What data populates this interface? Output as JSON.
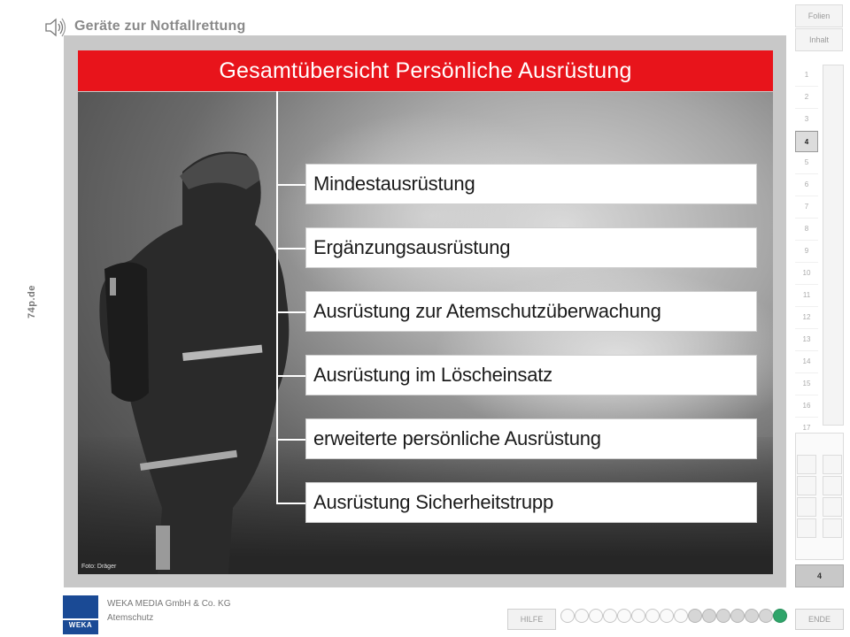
{
  "header": {
    "title": "Geräte zur Notfallrettung",
    "speaker_icon": "speaker-icon",
    "side_brand": "74p.de"
  },
  "slide": {
    "title": "Gesamtübersicht Persönliche Ausrüstung",
    "photo_credit": "Foto: Dräger",
    "items": [
      "Mindestausrüstung",
      "Ergänzungsausrüstung",
      "Ausrüstung zur Atemschutzüberwachung",
      "Ausrüstung im Löscheinsatz",
      "erweiterte persönliche Ausrüstung",
      "Ausrüstung Sicherheitstrupp"
    ]
  },
  "nav": {
    "folien": "Folien",
    "inhalt": "Inhalt",
    "slides": [
      "1",
      "2",
      "3",
      "4",
      "5",
      "6",
      "7",
      "8",
      "9",
      "10",
      "11",
      "12",
      "13",
      "14",
      "15",
      "16",
      "17"
    ],
    "active_slide": "4",
    "current_slide_label": "4"
  },
  "footer": {
    "company": "WEKA MEDIA GmbH & Co. KG",
    "subject": "Atemschutz",
    "logo_text": "WEKA",
    "hilfe": "HILFE",
    "ende": "ENDE",
    "progress": {
      "total": 16,
      "seen": 15,
      "current": 16
    }
  },
  "colors": {
    "title_bar": "#e8141b",
    "logo": "#1a4a95",
    "progress_active": "#2fa56a"
  }
}
